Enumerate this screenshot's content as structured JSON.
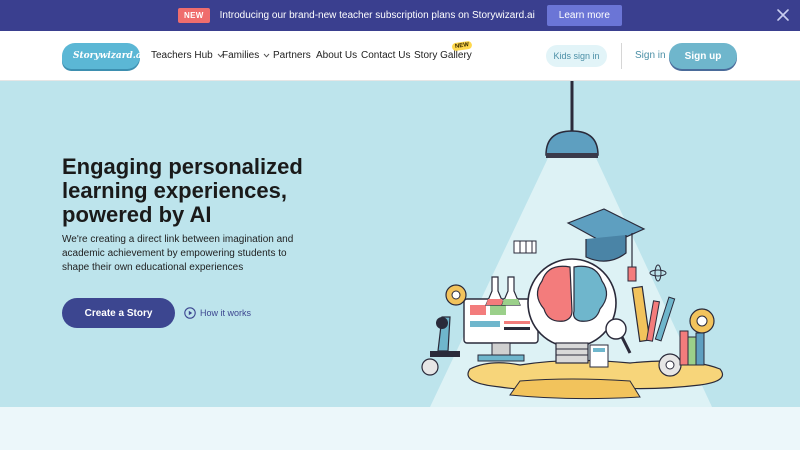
{
  "announcement": {
    "badge": "NEW",
    "message": "Introducing our brand-new teacher subscription plans on Storywizard.ai",
    "button": "Learn more",
    "close_icon": "close-icon"
  },
  "nav": {
    "logo_text": "Storywizard.ai",
    "items": [
      {
        "label": "Teachers Hub",
        "dropdown": true
      },
      {
        "label": "Families",
        "dropdown": true
      },
      {
        "label": "Partners",
        "dropdown": false
      },
      {
        "label": "About Us",
        "dropdown": false
      },
      {
        "label": "Contact Us",
        "dropdown": false
      },
      {
        "label": "Story Gallery",
        "dropdown": false
      }
    ],
    "new_tag": "NEW",
    "kids_sign_in": "Kids sign in",
    "sign_in": "Sign in",
    "sign_up": "Sign up"
  },
  "hero": {
    "headline": "Engaging personalized learning experiences, powered by AI",
    "subtext": "We're creating a direct link between imagination and academic achievement by empowering students to shape their own educational experiences",
    "cta": "Create a Story",
    "how_it_works": "How it works",
    "illustration": "lightbulb-brain-education-illustration"
  },
  "colors": {
    "announce_bg": "#3a3f8f",
    "hero_bg": "#bde4ec",
    "cta_bg": "#3c4690",
    "signup_bg": "#6fb6cc"
  }
}
